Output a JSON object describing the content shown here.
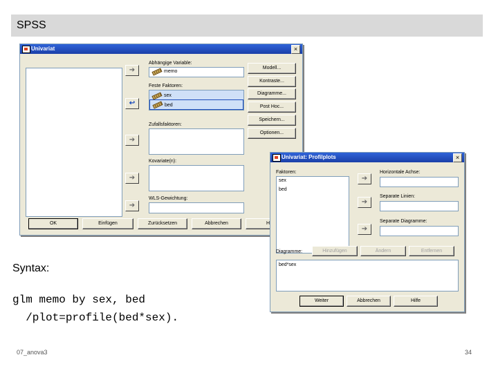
{
  "slide": {
    "title": "SPSS",
    "syntax_label": "Syntax:",
    "syntax_line1": "glm memo by sex, bed",
    "syntax_line2": "  /plot=profile(bed*sex).",
    "footer_left": "07_anova3",
    "page_number": "34"
  },
  "univariat": {
    "title": "Univariat",
    "close_label": "×",
    "dependent_label": "Abhängige Variable:",
    "dependent_value": "memo",
    "fixed_factors_label": "Feste Faktoren:",
    "fixed_factors": [
      "sex",
      "bed"
    ],
    "random_factors_label": "Zufallsfaktoren:",
    "covariates_label": "Kovariate(n):",
    "wls_label": "WLS-Gewichtung:",
    "side_buttons": [
      "Modell...",
      "Kontraste...",
      "Diagramme...",
      "Post Hoc...",
      "Speichern...",
      "Optionen..."
    ],
    "bottom_buttons": [
      "OK",
      "Einfügen",
      "Zurücksetzen",
      "Abbrechen",
      "Hilfe"
    ]
  },
  "profilplots": {
    "title": "Univariat: Profilplots",
    "close_label": "×",
    "factors_label": "Faktoren:",
    "factors": [
      "sex",
      "bed"
    ],
    "horizontal_axis_label": "Horizontale Achse:",
    "separate_lines_label": "Separate Linien:",
    "separate_diagrams_label": "Separate Diagramme:",
    "diagrams_label": "Diagramme:",
    "diagram_buttons": [
      "Hinzufügen",
      "Ändern",
      "Entfernen"
    ],
    "diagrams": [
      "bed*sex"
    ],
    "bottom_buttons": [
      "Weiter",
      "Abbrechen",
      "Hilfe"
    ]
  }
}
